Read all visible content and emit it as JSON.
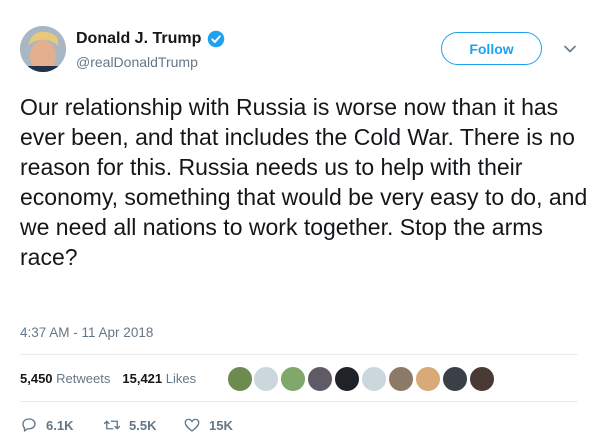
{
  "tweet": {
    "author": {
      "display_name": "Donald J. Trump",
      "handle": "@realDonaldTrump",
      "verified": true
    },
    "follow_label": "Follow",
    "text": "Our relationship with Russia is worse now than it has ever been, and that includes the Cold War. There is no reason for this. Russia needs us to help with their economy, something that would be very easy to do, and we need all nations to work together. Stop the arms race?",
    "timestamp": "4:37 AM - 11 Apr 2018",
    "stats": {
      "retweets_count": "5,450",
      "retweets_label": "Retweets",
      "likes_count": "15,421",
      "likes_label": "Likes"
    },
    "likers_count_shown": 10,
    "actions": {
      "reply_count": "6.1K",
      "retweet_count": "5.5K",
      "like_count": "15K"
    }
  },
  "colors": {
    "accent": "#1da1f2",
    "secondary_text": "#657786",
    "primary_text": "#14171a",
    "divider": "#e6ecf0"
  },
  "icons": [
    "verified-badge-icon",
    "chevron-down-icon",
    "reply-icon",
    "retweet-icon",
    "like-icon"
  ]
}
